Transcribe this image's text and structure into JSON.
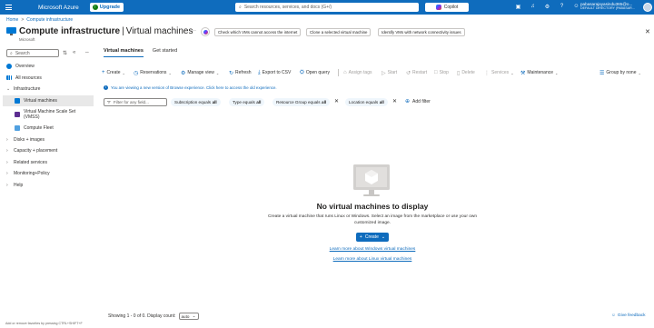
{
  "topbar": {
    "brand": "Microsoft Azure",
    "upgrade": "Upgrade",
    "search_placeholder": "Search resources, services, and docs (G+/)",
    "copilot": "Copilot",
    "user_name": "pabasarajayasindu365@o...",
    "user_directory": "DEFAULT DIRECTORY (PABASAR...",
    "icons": [
      "terminal-icon",
      "bell-icon",
      "settings-icon",
      "help-icon",
      "feedback-icon"
    ]
  },
  "breadcrumb": {
    "home": "Home",
    "sep": ">",
    "current": "Compute infrastructure"
  },
  "header": {
    "title_bold": "Compute infrastructure",
    "title_sep": "|",
    "title_rest": "Virtual machines",
    "subtitle": "Microsoft",
    "more": "···",
    "quick_actions": [
      "Check which VMs cannot access the internet",
      "Clone a selected virtual machine",
      "Identify VMs with network connectivity issues"
    ],
    "close": "✕"
  },
  "sidebar": {
    "search_placeholder": "Search",
    "items": [
      {
        "label": "Overview"
      },
      {
        "label": "All resources"
      },
      {
        "label": "Infrastructure"
      },
      {
        "label": "Virtual machines"
      },
      {
        "label": "Virtual Machine Scale Set (VMSS)"
      },
      {
        "label": "Compute Fleet"
      },
      {
        "label": "Disks + images"
      },
      {
        "label": "Capacity + placement"
      },
      {
        "label": "Related services"
      },
      {
        "label": "Monitoring+Policy"
      },
      {
        "label": "Help"
      }
    ]
  },
  "tabs": [
    "Virtual machines",
    "Get started"
  ],
  "toolbar": {
    "create": "Create",
    "reservations": "Reservations",
    "manage_view": "Manage view",
    "refresh": "Refresh",
    "export_csv": "Export to CSV",
    "open_query": "Open query",
    "assign_tags": "Assign tags",
    "start": "Start",
    "restart": "Restart",
    "stop": "Stop",
    "delete": "Delete",
    "services": "Services",
    "maintenance": "Maintenance",
    "group_by": "Group by none"
  },
  "info_link": "You are viewing a new version of Browse experience. Click here to access the old experience.",
  "filters": {
    "input_placeholder": "Filter for any field...",
    "pills": [
      {
        "key": "Subscription equals",
        "value": "all"
      },
      {
        "key": "Type equals",
        "value": "all"
      },
      {
        "key": "Resource Group equals",
        "value": "all"
      },
      {
        "key": "Location equals",
        "value": "all"
      }
    ],
    "add_filter": "Add filter"
  },
  "empty": {
    "title": "No virtual machines to display",
    "description": "Create a virtual machine that runs Linux or Windows. Select an image from the marketplace or use your own customized image.",
    "create_button": "Create",
    "link_windows": "Learn more about Windows virtual machines",
    "link_linux": "Learn more about Linux virtual machines"
  },
  "footer": {
    "paging_text": "Showing 1 - 0 of 0. Display count:",
    "display_count": "auto",
    "give_feedback": "Give feedback",
    "hint": "Add or remove favorites by pressing CTRL+SHIFT+F"
  },
  "colors": {
    "accent": "#0f6cbd",
    "topbar": "#0f6cbd",
    "upgrade_badge": "#107c10"
  }
}
